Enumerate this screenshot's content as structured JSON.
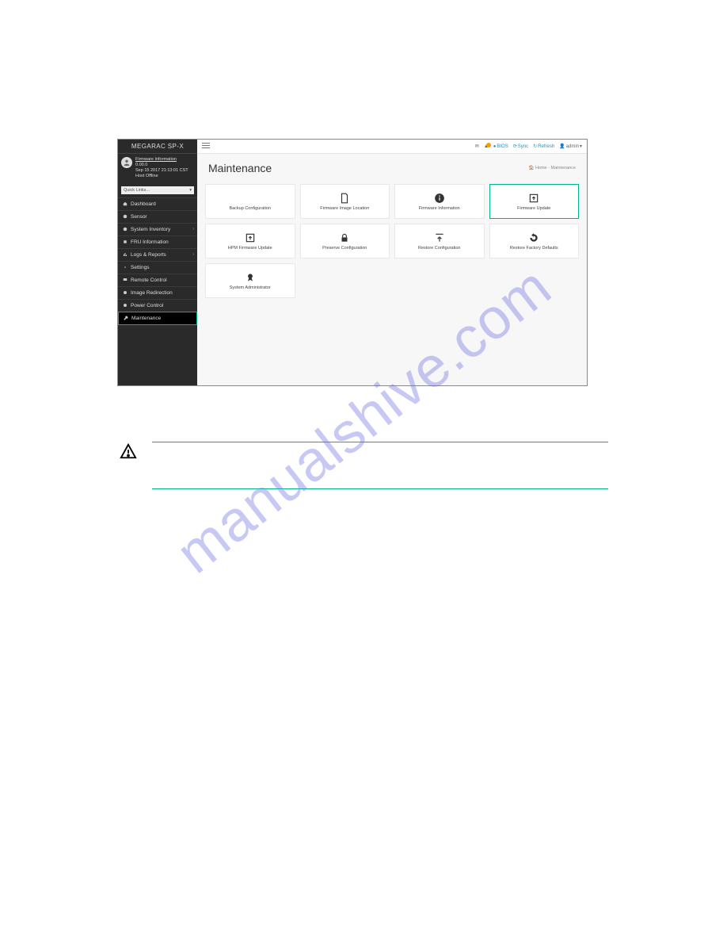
{
  "branding": "MEGARAC SP-X",
  "user": {
    "firmware_link": "Firmware Information",
    "version": "0.00.0",
    "timestamp": "Sep 15 2017 21:13:01 CST",
    "host_status": "Host Offline"
  },
  "quicklinks_placeholder": "Quick Links...",
  "sidebar": {
    "items": [
      {
        "label": "Dashboard"
      },
      {
        "label": "Sensor"
      },
      {
        "label": "System Inventory",
        "has_sub": true
      },
      {
        "label": "FRU Information"
      },
      {
        "label": "Logs & Reports",
        "has_sub": true
      },
      {
        "label": "Settings"
      },
      {
        "label": "Remote Control"
      },
      {
        "label": "Image Redirection"
      },
      {
        "label": "Power Control"
      },
      {
        "label": "Maintenance",
        "active": true
      }
    ]
  },
  "topbar": {
    "bios": "BIOS",
    "sync": "Sync",
    "refresh": "Refresh",
    "user": "admin"
  },
  "breadcrumb": {
    "home": "Home",
    "page": "Maintenance"
  },
  "page_title": "Maintenance",
  "tiles": [
    {
      "label": "Backup Configuration",
      "icon": "download"
    },
    {
      "label": "Firmware Image Location",
      "icon": "file"
    },
    {
      "label": "Firmware Information",
      "icon": "info"
    },
    {
      "label": "Firmware Update",
      "icon": "up-box",
      "selected": true
    },
    {
      "label": "HPM Firmware Update",
      "icon": "up-box"
    },
    {
      "label": "Preserve Configuration",
      "icon": "lock"
    },
    {
      "label": "Restore Configuration",
      "icon": "upload"
    },
    {
      "label": "Restore Factory Defaults",
      "icon": "undo"
    },
    {
      "label": "System Administrator",
      "icon": "badge"
    }
  ],
  "watermark": "manualshive.com"
}
